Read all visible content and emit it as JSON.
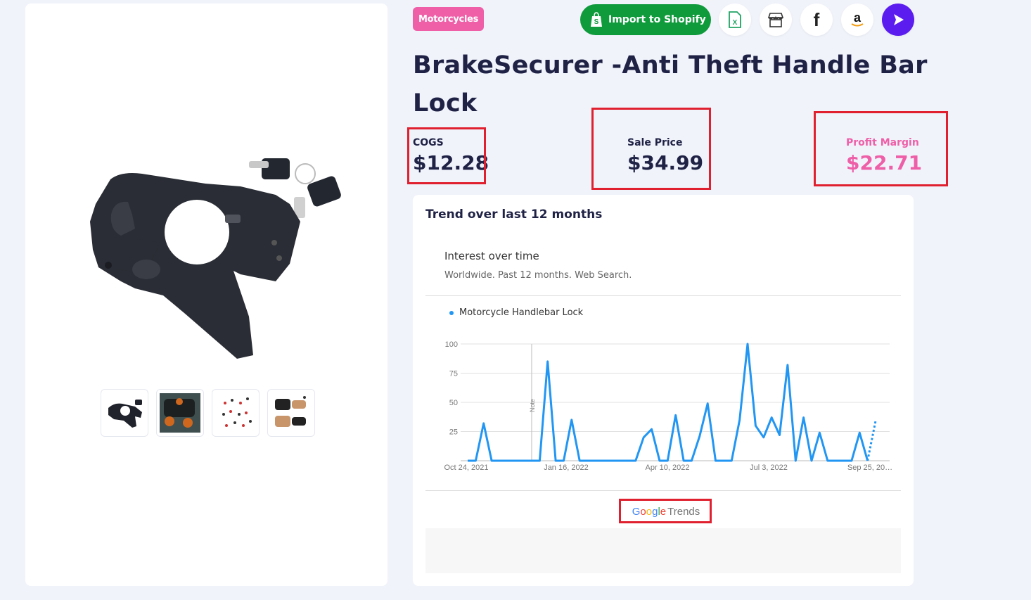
{
  "category": "Motorcycles",
  "actions": {
    "import_label": "Import to Shopify"
  },
  "product": {
    "title": "BrakeSecurer -Anti Theft Handle Bar Lock"
  },
  "metrics": {
    "cogs_label": "COGS",
    "cogs_value": "$12.28",
    "sale_label": "Sale Price",
    "sale_value": "$34.99",
    "profit_label": "Profit Margin",
    "profit_value": "$22.71"
  },
  "trend": {
    "heading": "Trend over last 12 months",
    "widget_title": "Interest over time",
    "widget_subtitle": "Worldwide. Past 12 months. Web Search.",
    "brand_google": "Google",
    "brand_trends": "Trends"
  },
  "chart_data": {
    "type": "line",
    "x_tick_labels": [
      "Oct 24, 2021",
      "Jan 16, 2022",
      "Apr 10, 2022",
      "Jul 3, 2022",
      "Sep 25, 20…"
    ],
    "y_ticks": [
      25,
      50,
      75,
      100
    ],
    "ylim": [
      0,
      100
    ],
    "grid": true,
    "legend_position": "top-left",
    "annotation": "Note",
    "series": [
      {
        "name": "Motorcycle Handlebar Lock",
        "color": "#2196f3",
        "values": [
          0,
          0,
          32,
          0,
          0,
          0,
          0,
          0,
          0,
          0,
          85,
          0,
          0,
          35,
          0,
          0,
          0,
          0,
          0,
          0,
          0,
          0,
          20,
          27,
          0,
          0,
          39,
          0,
          0,
          21,
          49,
          0,
          0,
          0,
          35,
          100,
          30,
          20,
          37,
          22,
          82,
          0,
          37,
          0,
          24,
          0,
          0,
          0,
          0,
          24,
          0
        ],
        "partial_tail_values": [
          0,
          34
        ]
      }
    ]
  },
  "colors": {
    "accent_pink": "#ee5fa8",
    "shopify_green": "#0f9a3c",
    "title_navy": "#1f2245",
    "highlight_red": "#e0202e",
    "line_blue": "#2196f3"
  },
  "icons": [
    "shopify-bag-icon",
    "excel-icon",
    "store-icon",
    "facebook-icon",
    "amazon-icon",
    "play-icon"
  ]
}
